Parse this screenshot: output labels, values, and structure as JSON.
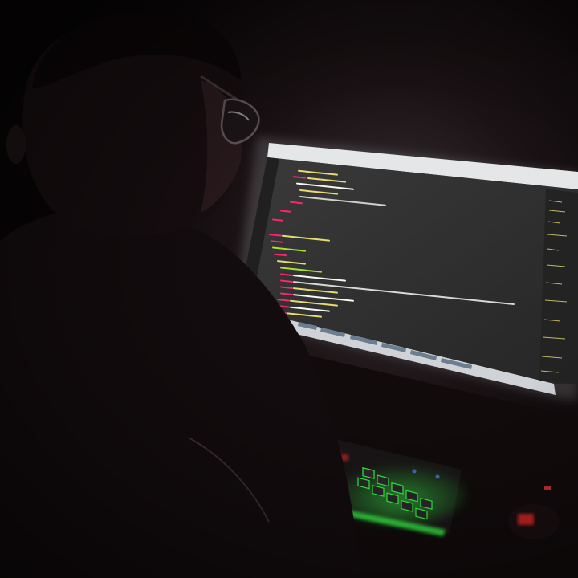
{
  "scene": {
    "subject": "person-at-computer",
    "lighting": "dark-room-monitor-glow",
    "colors": {
      "room": "#0b0708",
      "silhouette": "#120c0e",
      "screen_bg": "#2b2b2b",
      "screen_glow": "#d7dbe0",
      "code_yellow": "#e6db74",
      "code_red": "#f92672",
      "code_green": "#a6e22e",
      "code_white": "#f8f8f2",
      "keyboard_green": "#39ff4a",
      "keyboard_red": "#ff2a2a"
    },
    "icons": [
      "glasses-icon",
      "monitor-icon",
      "keyboard-icon",
      "mouse-icon"
    ]
  }
}
